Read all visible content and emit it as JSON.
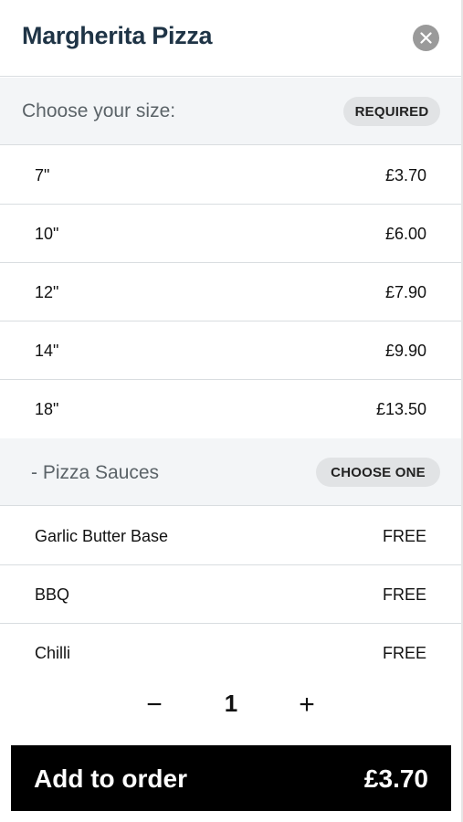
{
  "header": {
    "title": "Margherita Pizza",
    "close_icon": "close-icon"
  },
  "size_section": {
    "label": "Choose your size:",
    "badge": "REQUIRED",
    "options": [
      {
        "name": "7\"",
        "price": "£3.70"
      },
      {
        "name": "10\"",
        "price": "£6.00"
      },
      {
        "name": "12\"",
        "price": "£7.90"
      },
      {
        "name": "14\"",
        "price": "£9.90"
      },
      {
        "name": "18\"",
        "price": "£13.50"
      }
    ]
  },
  "sauce_section": {
    "label": "- Pizza Sauces",
    "badge": "CHOOSE ONE",
    "options": [
      {
        "name": "Garlic Butter Base",
        "price": "FREE"
      },
      {
        "name": "BBQ",
        "price": "FREE"
      },
      {
        "name": "Chilli",
        "price": "FREE"
      }
    ]
  },
  "stepper": {
    "minus": "−",
    "quantity": "1",
    "plus": "+"
  },
  "add_button": {
    "label": "Add to order",
    "price": "£3.70"
  },
  "colors": {
    "title": "#1f3446",
    "section_bg": "#f3f5f7",
    "button_bg": "#000000",
    "close_bg": "#9a9a9a"
  }
}
